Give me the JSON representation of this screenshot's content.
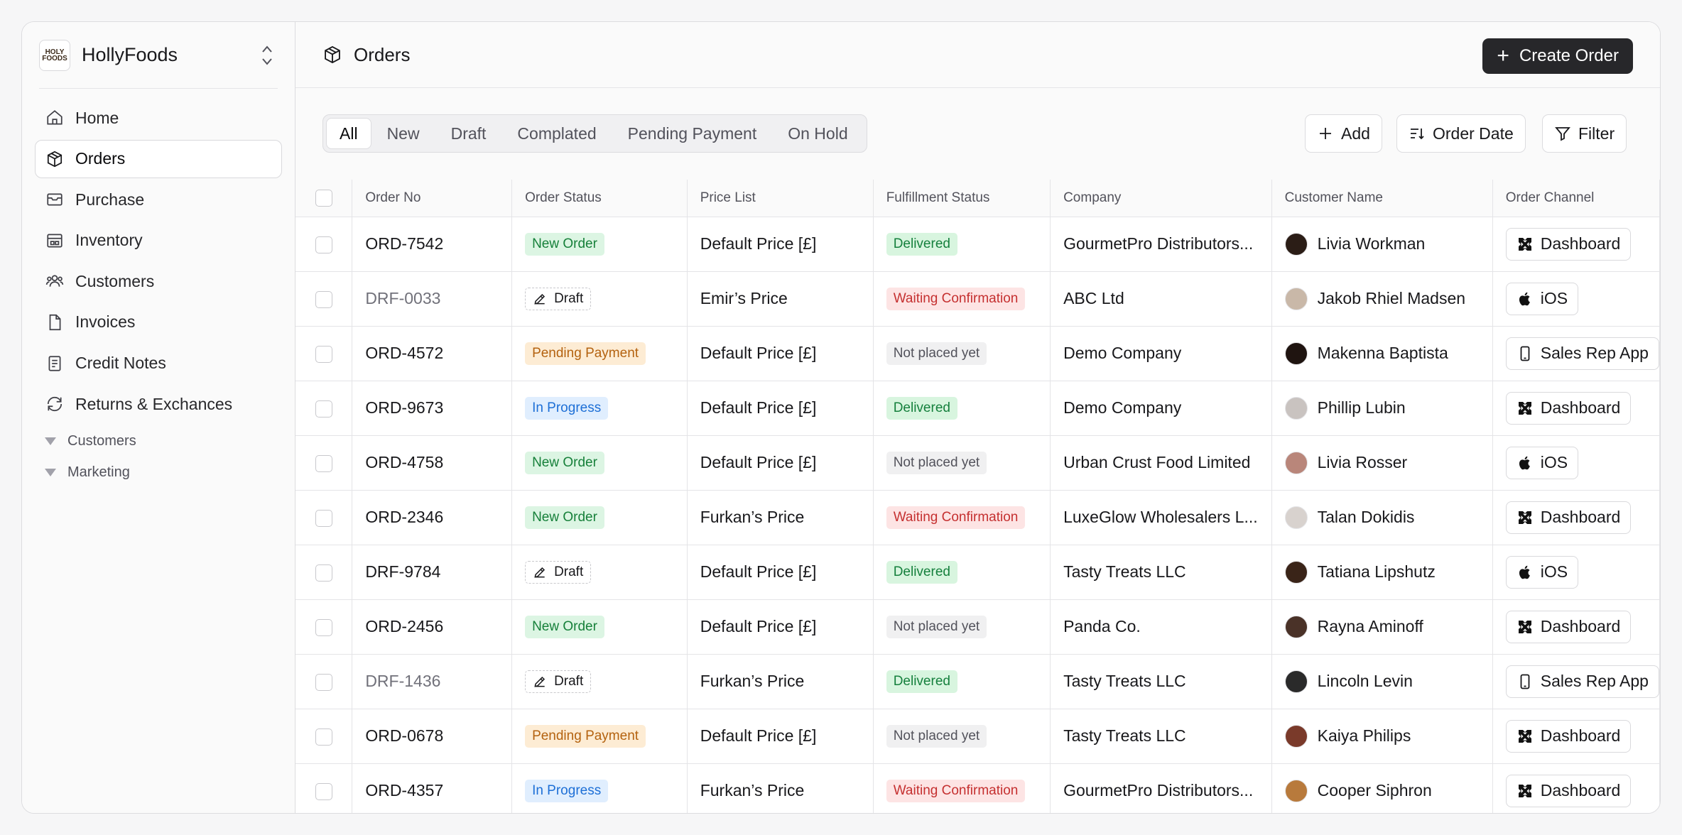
{
  "brand": {
    "name": "HollyFoods",
    "logo_text": "HOLY FOODS"
  },
  "sidebar": {
    "items": [
      {
        "label": "Home",
        "icon": "home-icon"
      },
      {
        "label": "Orders",
        "icon": "package-icon"
      },
      {
        "label": "Purchase",
        "icon": "purchase-icon"
      },
      {
        "label": "Inventory",
        "icon": "warehouse-icon"
      },
      {
        "label": "Customers",
        "icon": "users-icon"
      },
      {
        "label": "Invoices",
        "icon": "file-icon"
      },
      {
        "label": "Credit Notes",
        "icon": "receipt-icon"
      },
      {
        "label": "Returns & Exchances",
        "icon": "refresh-icon"
      }
    ],
    "groups": [
      {
        "label": "Customers"
      },
      {
        "label": "Marketing"
      }
    ]
  },
  "header": {
    "title": "Orders",
    "create_label": "Create Order"
  },
  "tabs": [
    "All",
    "New",
    "Draft",
    "Complated",
    "Pending Payment",
    "On Hold"
  ],
  "toolbar": {
    "add_label": "Add",
    "sort_label": "Order Date",
    "filter_label": "Filter"
  },
  "table": {
    "columns": [
      "Order No",
      "Order Status",
      "Price List",
      "Fulfillment Status",
      "Company",
      "Customer Name",
      "Order Channel"
    ],
    "rows": [
      {
        "order": "ORD-7542",
        "status": "New Order",
        "price": "Default Price [£]",
        "fulfill": "Delivered",
        "company": "GourmetPro Distributors...",
        "customer": "Livia Workman",
        "channel": "Dashboard"
      },
      {
        "order": "DRF-0033",
        "status": "Draft",
        "price": "Emir’s Price",
        "fulfill": "Waiting Confirmation",
        "company": "ABC Ltd",
        "customer": "Jakob Rhiel Madsen",
        "channel": "iOS"
      },
      {
        "order": "ORD-4572",
        "status": "Pending Payment",
        "price": "Default Price [£]",
        "fulfill": "Not placed yet",
        "company": "Demo Company",
        "customer": "Makenna Baptista",
        "channel": "Sales Rep App"
      },
      {
        "order": "ORD-9673",
        "status": "In Progress",
        "price": "Default Price [£]",
        "fulfill": "Delivered",
        "company": "Demo Company",
        "customer": "Phillip Lubin",
        "channel": "Dashboard"
      },
      {
        "order": "ORD-4758",
        "status": "New Order",
        "price": "Default Price [£]",
        "fulfill": "Not placed yet",
        "company": "Urban Crust Food Limited",
        "customer": "Livia Rosser",
        "channel": "iOS"
      },
      {
        "order": "ORD-2346",
        "status": "New Order",
        "price": "Furkan’s Price",
        "fulfill": "Waiting Confirmation",
        "company": "LuxeGlow Wholesalers L...",
        "customer": "Talan Dokidis",
        "channel": "Dashboard"
      },
      {
        "order": "DRF-9784",
        "status": "Draft",
        "price": "Default Price [£]",
        "fulfill": "Delivered",
        "company": "Tasty Treats LLC",
        "customer": "Tatiana Lipshutz",
        "channel": "iOS"
      },
      {
        "order": "ORD-2456",
        "status": "New Order",
        "price": "Default Price [£]",
        "fulfill": "Not placed yet",
        "company": "Panda Co.",
        "customer": "Rayna Aminoff",
        "channel": "Dashboard"
      },
      {
        "order": "DRF-1436",
        "status": "Draft",
        "price": "Furkan’s Price",
        "fulfill": "Delivered",
        "company": "Tasty Treats LLC",
        "customer": "Lincoln Levin",
        "channel": "Sales Rep App"
      },
      {
        "order": "ORD-0678",
        "status": "Pending Payment",
        "price": "Default Price [£]",
        "fulfill": "Not placed yet",
        "company": "Tasty Treats LLC",
        "customer": "Kaiya Philips",
        "channel": "Dashboard"
      },
      {
        "order": "ORD-4357",
        "status": "In Progress",
        "price": "Furkan’s Price",
        "fulfill": "Waiting Confirmation",
        "company": "GourmetPro Distributors...",
        "customer": "Cooper Siphron",
        "channel": "Dashboard"
      }
    ]
  },
  "colors": {
    "new_order": "#16803a",
    "pending": "#b4620f",
    "in_progress": "#1d6fd6",
    "delivered": "#15803d",
    "waiting": "#c53030",
    "primary_button": "#27272a"
  }
}
